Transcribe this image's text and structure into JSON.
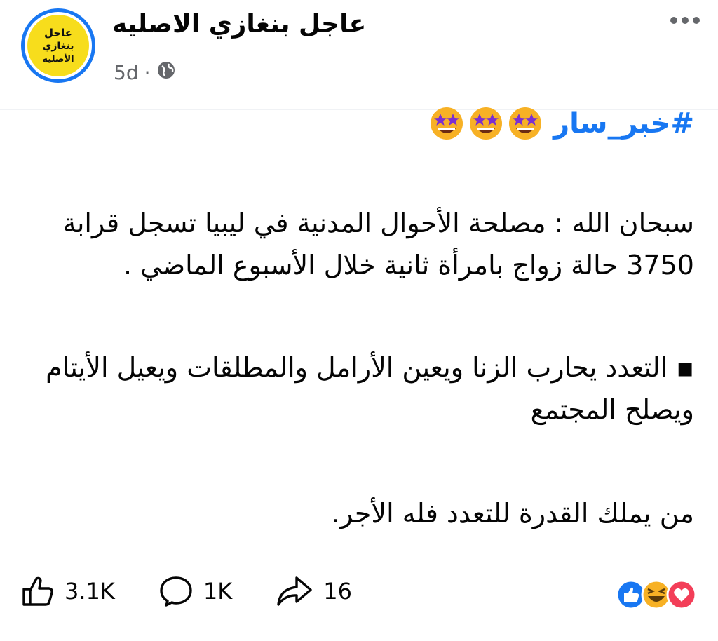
{
  "header": {
    "page_name": "عاجل بنغازي الاصليه",
    "avatar_text_line1": "عاجل",
    "avatar_text_line2": "بنغازي",
    "avatar_text_line3": "الأصليه",
    "time": "5d",
    "separator": "·",
    "privacy_icon": "globe-icon",
    "more_icon": "more-options-icon"
  },
  "post": {
    "hashtag": "#خبر_سار",
    "hashtag_emoji": "star-struck-emoji",
    "hashtag_emoji_count": 3,
    "paragraph1": "سبحان الله : مصلحة الأحوال المدنية في ليبيا تسجل قرابة 3750 حالة زواج بامرأة ثانية خلال الأسبوع الماضي .",
    "paragraph2": "▪︎ التعدد يحارب الزنا ويعين الأرامل والمطلقات ويعيل الأيتام ويصلح المجتمع",
    "paragraph3": "من يملك القدرة للتعدد فله الأجر."
  },
  "actions": {
    "like_count": "3.1K",
    "comment_count": "1K",
    "share_count": "16"
  },
  "reactions": [
    "like",
    "haha",
    "love"
  ],
  "colors": {
    "accent": "#1877f2",
    "avatar_bg": "#f7dd1c",
    "love": "#f33e58",
    "haha": "#f7b125",
    "secondary_text": "#65676b"
  }
}
